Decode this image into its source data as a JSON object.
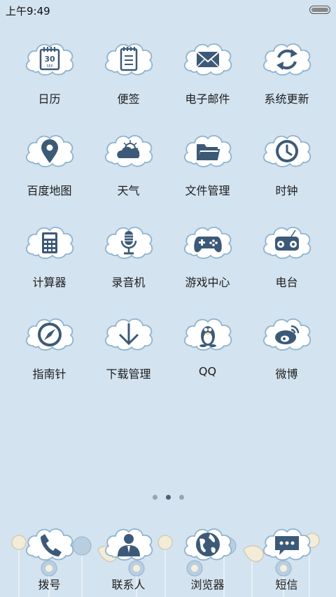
{
  "status": {
    "time": "上午9:49"
  },
  "apps": [
    {
      "label": "日历",
      "icon": "calendar-icon",
      "day": "30",
      "sub": "SEP"
    },
    {
      "label": "便签",
      "icon": "notepad-icon"
    },
    {
      "label": "电子邮件",
      "icon": "mail-icon"
    },
    {
      "label": "系统更新",
      "icon": "refresh-icon"
    },
    {
      "label": "百度地图",
      "icon": "map-pin-icon"
    },
    {
      "label": "天气",
      "icon": "weather-icon"
    },
    {
      "label": "文件管理",
      "icon": "folder-icon"
    },
    {
      "label": "时钟",
      "icon": "clock-icon"
    },
    {
      "label": "计算器",
      "icon": "calculator-icon"
    },
    {
      "label": "录音机",
      "icon": "microphone-icon"
    },
    {
      "label": "游戏中心",
      "icon": "gamepad-icon"
    },
    {
      "label": "电台",
      "icon": "radio-icon"
    },
    {
      "label": "指南针",
      "icon": "compass-icon"
    },
    {
      "label": "下载管理",
      "icon": "download-icon"
    },
    {
      "label": "QQ",
      "icon": "qq-penguin-icon"
    },
    {
      "label": "微博",
      "icon": "weibo-icon"
    }
  ],
  "pages": {
    "count": 3,
    "active": 2
  },
  "dock": [
    {
      "label": "拨号",
      "icon": "phone-icon"
    },
    {
      "label": "联系人",
      "icon": "contacts-icon"
    },
    {
      "label": "浏览器",
      "icon": "globe-icon"
    },
    {
      "label": "短信",
      "icon": "message-icon"
    }
  ],
  "colors": {
    "background": "#d3e3ef",
    "icon": "#3c5a78",
    "cloud_fill": "#ffffff",
    "cloud_outline": "#8fb3cf"
  }
}
